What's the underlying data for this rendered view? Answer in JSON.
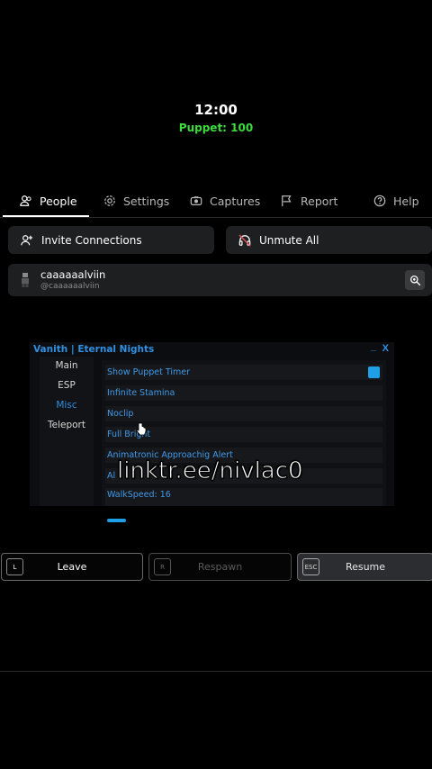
{
  "hud": {
    "clock": "12:00",
    "puppet": "Puppet: 100"
  },
  "tabs": [
    {
      "label": "People",
      "icon": "people-icon",
      "active": true
    },
    {
      "label": "Settings",
      "icon": "gear-icon"
    },
    {
      "label": "Captures",
      "icon": "camera-icon"
    },
    {
      "label": "Report",
      "icon": "flag-icon"
    },
    {
      "label": "Help",
      "icon": "help-icon"
    }
  ],
  "actions": {
    "invite_label": "Invite Connections",
    "unmute_label": "Unmute All"
  },
  "user": {
    "display_name": "caaaaaalviin",
    "handle": "@caaaaaalviin"
  },
  "panel": {
    "title": "Vanith | Eternal Nights",
    "minimize": "_",
    "close": "X",
    "sidebar": [
      "Main",
      "ESP",
      "Misc",
      "Teleport"
    ],
    "active_sidebar": "Misc",
    "options": [
      "Show Puppet Timer",
      "Infinite Stamina",
      "Noclip",
      "Full Bright",
      "Animatronic Approachig Alert",
      "Al"
    ],
    "show_puppet_timer_enabled": true,
    "walkspeed_label": "WalkSpeed: 16",
    "walkspeed_value": 16,
    "accent": "#2f8fe0"
  },
  "watermark": "linktr.ee/nivlac0",
  "bottom_bar": {
    "leave": {
      "key": "L",
      "label": "Leave"
    },
    "respawn": {
      "key": "R",
      "label": "Respawn"
    },
    "resume": {
      "key": "ESC",
      "label": "Resume"
    }
  },
  "colors": {
    "puppet_green": "#3ddc3d",
    "background": "#000000"
  }
}
